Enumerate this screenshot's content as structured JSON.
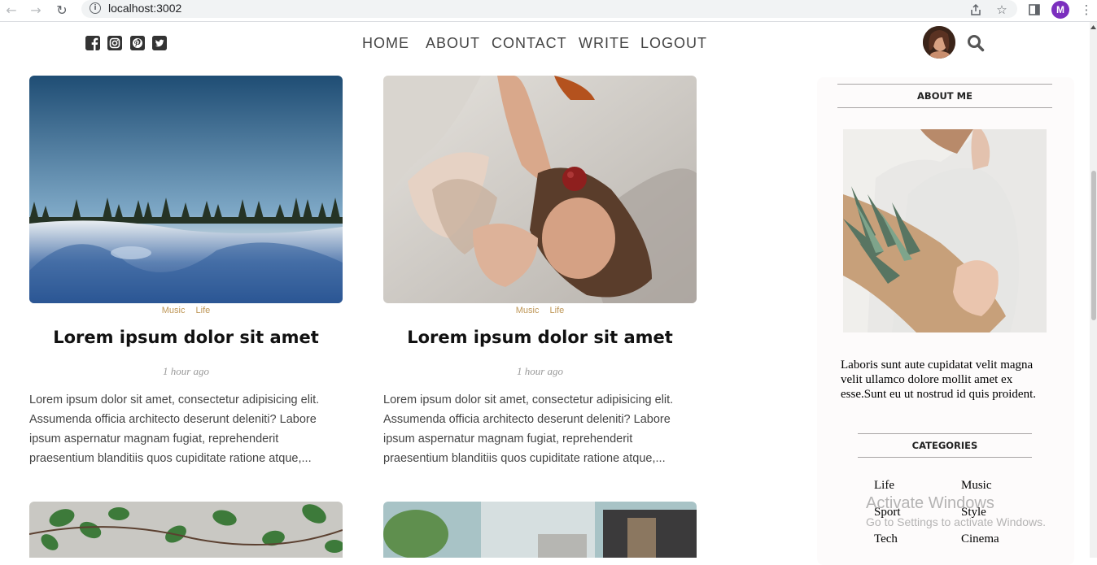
{
  "browser": {
    "url": "localhost:3002",
    "profile_initial": "M",
    "icons": [
      "back-arrow-icon",
      "forward-arrow-icon",
      "reload-icon",
      "site-info-icon",
      "share-icon",
      "star-icon",
      "sidebar-icon",
      "kebab-menu-icon"
    ]
  },
  "topbar": {
    "social": [
      "facebook-icon",
      "instagram-icon",
      "pinterest-icon",
      "twitter-icon"
    ],
    "menu": [
      "HOME",
      "ABOUT",
      "CONTACT",
      "WRITE",
      "LOGOUT"
    ]
  },
  "posts": [
    {
      "categories": [
        "Music",
        "Life"
      ],
      "title": "Lorem ipsum dolor sit amet",
      "date": "1 hour ago",
      "desc": "Lorem ipsum dolor sit amet, consectetur adipisicing elit. Assumenda officia architecto deserunt deleniti? Labore ipsum aspernatur magnam fugiat, reprehenderit praesentium blanditiis quos cupiditate ratione atque,...",
      "image": "snowy-landscape"
    },
    {
      "categories": [
        "Music",
        "Life"
      ],
      "title": "Lorem ipsum dolor sit amet",
      "date": "1 hour ago",
      "desc": "Lorem ipsum dolor sit amet, consectetur adipisicing elit. Assumenda officia architecto deserunt deleniti? Labore ipsum aspernatur magnam fugiat, reprehenderit praesentium blanditiis quos cupiditate ratione atque,...",
      "image": "woman-with-apple"
    }
  ],
  "sidebar": {
    "about_title": "ABOUT ME",
    "about_text": "Laboris sunt aute cupidatat velit magna velit ullamco dolore mollit amet ex esse.Sunt eu ut nostrud id quis proident.",
    "categories_title": "CATEGORIES",
    "categories": [
      "Life",
      "Music",
      "Sport",
      "Style",
      "Tech",
      "Cinema"
    ]
  },
  "watermark": {
    "line1": "Activate Windows",
    "line2": "Go to Settings to activate Windows."
  }
}
